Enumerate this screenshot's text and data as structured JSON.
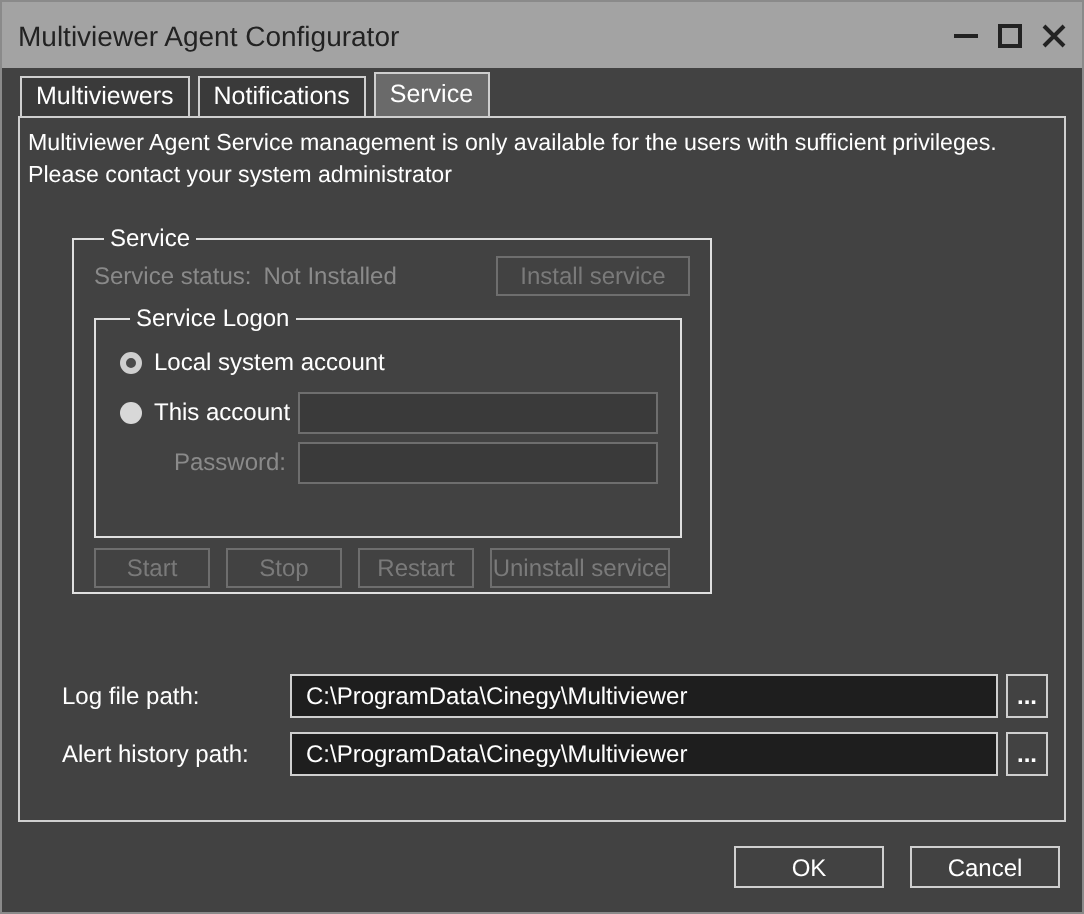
{
  "window": {
    "title": "Multiviewer Agent Configurator"
  },
  "tabs": [
    {
      "label": "Multiviewers",
      "selected": false
    },
    {
      "label": "Notifications",
      "selected": false
    },
    {
      "label": "Service",
      "selected": true
    }
  ],
  "message_lines": [
    "Multiviewer Agent Service management is only available for the users with sufficient privileges.",
    "Please contact your system administrator"
  ],
  "service": {
    "title": "Service",
    "status_label": "Service status:",
    "status_value": "Not Installed",
    "status_disabled": true,
    "install_button": {
      "label": "Install service",
      "disabled": true
    },
    "logon": {
      "title": "Service Logon",
      "options": [
        {
          "label": "Local system account",
          "selected": true,
          "kind": "plain"
        },
        {
          "label": "This account",
          "selected": false,
          "kind": "field"
        }
      ],
      "password_label": "Password:",
      "password_disabled": true
    },
    "actions": [
      {
        "label": "Start",
        "disabled": true
      },
      {
        "label": "Stop",
        "disabled": true
      },
      {
        "label": "Restart",
        "disabled": true
      },
      {
        "label": "Uninstall service",
        "disabled": true
      }
    ]
  },
  "paths": [
    {
      "label": "Log file path:",
      "value": "C:\\ProgramData\\Cinegy\\Multiviewer",
      "browse": "..."
    },
    {
      "label": "Alert history path:",
      "value": "C:\\ProgramData\\Cinegy\\Multiviewer",
      "browse": "..."
    }
  ],
  "buttons": [
    {
      "label": "OK"
    },
    {
      "label": "Cancel"
    }
  ]
}
